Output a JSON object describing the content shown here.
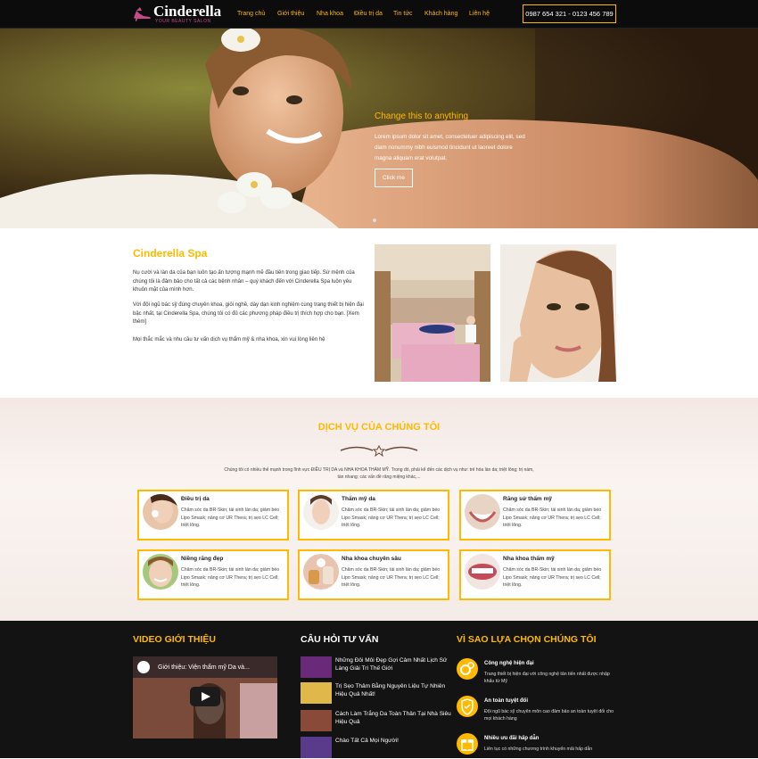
{
  "brand": {
    "name": "Cinderella",
    "tagline": "YOUR BEAUTY SALON"
  },
  "nav": {
    "items": [
      "Trang chủ",
      "Giới thiệu",
      "Nha khoa",
      "Điều trị da",
      "Tin tức",
      "Khách hàng",
      "Liên hệ"
    ],
    "hotline": "0987 654 321 - 0123 456 789"
  },
  "hero": {
    "title": "Change this to anything",
    "text": "Lorem ipsum dolor sit amet, consectetuer adipiscing elit, sed diam nonummy nibh euismod tincidunt ut laoreet dolore magna aliquam erat volutpat.",
    "button": "Click me"
  },
  "about": {
    "title": "Cinderella Spa",
    "p1": "Nụ cười và làn da của bạn luôn tạo ấn tượng mạnh mẽ đầu tiên trong giao tiếp. Sứ mệnh của chúng tôi là đảm bảo cho tất cả các bệnh nhân – quý khách đến với Cinderella Spa luôn yêu khuôn mặt của mình hơn.",
    "p2": "Với đội ngũ bác sỹ đúng chuyên khoa, giỏi nghề, dày dạn kinh nghiệm cùng trang thiết bị hiện đại bậc nhất, tại Cinderella Spa, chúng tôi có đủ các phương pháp điều trị thích hợp cho bạn. [Xem thêm]",
    "p3": "Mọi thắc mắc và nhu cầu tư vấn dịch vụ thẩm mỹ & nha khoa, xin vui lòng liên hệ"
  },
  "services": {
    "title": "DỊCH VỤ CỦA CHÚNG TÔI",
    "intro": "Chúng tôi có nhiều thế mạnh trong lĩnh vực ĐIỀU TRỊ DA và NHA KHOA THẨM MỸ. Trong đó, phải kể đến các dịch vụ như: trẻ hóa làn da; triệt lông; trị nám, tàn nhang; các vấn đề răng miệng khác,...",
    "cards": [
      {
        "title": "Điều trị da",
        "desc": "Chăm sóc da BR-Skin; tái sinh làn da; giảm béo Lipo Smask; nâng cơ UR Thera; trị sẹo LC Cell; triệt lông."
      },
      {
        "title": "Thẩm mỹ da",
        "desc": "Chăm sóc da BR-Skin; tái sinh làn da; giảm béo Lipo Smask; nâng cơ UR Thera; trị sẹo LC Cell; triệt lông."
      },
      {
        "title": "Răng sứ thẩm mỹ",
        "desc": "Chăm sóc da BR-Skin; tái sinh làn da; giảm béo Lipo Smask; nâng cơ UR Thera; trị sẹo LC Cell; triệt lông."
      },
      {
        "title": "Niềng răng đẹp",
        "desc": "Chăm sóc da BR-Skin; tái sinh làn da; giảm béo Lipo Smask; nâng cơ UR Thera; trị sẹo LC Cell; triệt lông."
      },
      {
        "title": "Nha khoa chuyên sâu",
        "desc": "Chăm sóc da BR-Skin; tái sinh làn da; giảm béo Lipo Smask; nâng cơ UR Thera; trị sẹo LC Cell; triệt lông."
      },
      {
        "title": "Nha khoa thẩm mỹ",
        "desc": "Chăm sóc da BR-Skin; tái sinh làn da; giảm béo Lipo Smask; nâng cơ UR Thera; trị sẹo LC Cell; triệt lông."
      }
    ]
  },
  "footer": {
    "video": {
      "heading": "VIDEO GIỚI THIỆU",
      "title": "Giới thiệu: Viện thẩm mỹ Da và..."
    },
    "faq": {
      "heading": "CÂU HỎI TƯ VẤN",
      "items": [
        "Những Đôi Môi Đẹp Gợi Cảm Nhất Lịch Sử Làng Giải Trí Thế Giới",
        "Trị Sẹo Thâm Bằng Nguyên Liệu Tự Nhiên Hiệu Quả Nhất!",
        "Cách Làm Trắng Da Toàn Thân Tại Nhà Siêu Hiệu Quả",
        "Chào Tất Cả Mọi Người!"
      ]
    },
    "why": {
      "heading": "VÌ SAO LỰA CHỌN CHÚNG TÔI",
      "items": [
        {
          "title": "Công nghệ hiện đại",
          "desc": "Trang thiết bị hiện đại với công nghệ tân tiến nhất được nhập khẩu từ Mỹ"
        },
        {
          "title": "An toàn tuyệt đối",
          "desc": "Đội ngũ bác sỹ chuyên môn cao đảm bảo an toàn tuyệt đối cho mọi khách hàng"
        },
        {
          "title": "Nhiều ưu đãi hấp dẫn",
          "desc": "Liên tục có những chương trình khuyến mãi hấp dẫn"
        }
      ]
    }
  },
  "colors": {
    "accent": "#ffb900",
    "dark": "#131313",
    "nav": "#0c0c0c"
  }
}
